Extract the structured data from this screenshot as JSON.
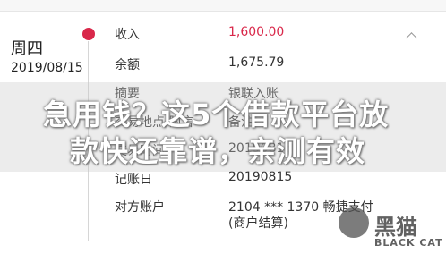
{
  "header": {
    "day": "周四",
    "date": "2019/08/15"
  },
  "rows": [
    {
      "label": "收入",
      "value": "1,600.00",
      "accent": "#d9284a"
    },
    {
      "label": "余额",
      "value": "1,675.79"
    },
    {
      "label": "摘要",
      "value": "银联入账"
    },
    {
      "label": "交易地点/附言",
      "value": "备注"
    },
    {
      "label": "交易时间",
      "value": "20190815"
    },
    {
      "label": "记账日",
      "value": "20190815"
    },
    {
      "label": "对方账户",
      "value": "2104 *** 1370 畅捷支付",
      "value_line2": "(商户结算)"
    }
  ],
  "overlay": {
    "line1": "急用钱？这5个借款平台放",
    "line2": "款快还靠谱，亲测有效"
  },
  "watermark": {
    "cn": "黑猫",
    "en": "BLACK CAT"
  },
  "colors": {
    "accent": "#d9284a",
    "timeline": "#d6d6d6"
  },
  "icons": [
    "dot-icon",
    "chevron-up-icon",
    "black-cat-logo-icon"
  ]
}
